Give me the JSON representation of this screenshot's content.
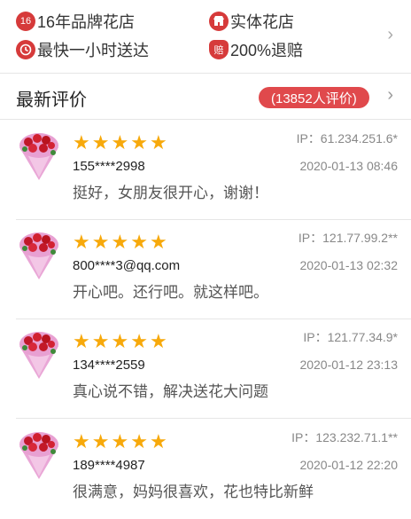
{
  "features": [
    {
      "icon": "16-years-icon",
      "icon_text": "16",
      "label": "16年品牌花店"
    },
    {
      "icon": "shop-icon",
      "icon_text": "",
      "label": "实体花店"
    },
    {
      "icon": "clock-icon",
      "icon_text": "",
      "label": "最快一小时送达"
    },
    {
      "icon": "refund-icon",
      "icon_text": "赔",
      "label": "200%退赔"
    }
  ],
  "reviews_header": {
    "title": "最新评价",
    "count": "(13852人评价)"
  },
  "rating_stars": 5,
  "reviews": [
    {
      "ip": "IP：61.234.251.6*",
      "user": "155****2998",
      "time": "2020-01-13 08:46",
      "text": "挺好，女朋友很开心，谢谢！"
    },
    {
      "ip": "IP：121.77.99.2**",
      "user": "800****3@qq.com",
      "time": "2020-01-13 02:32",
      "text": "开心吧。还行吧。就这样吧。"
    },
    {
      "ip": "IP：121.77.34.9*",
      "user": "134****2559",
      "time": "2020-01-12 23:13",
      "text": "真心说不错，解决送花大问题"
    },
    {
      "ip": "IP：123.232.71.1**",
      "user": "189****4987",
      "time": "2020-01-12 22:20",
      "text": "很满意，妈妈很喜欢，花也特比新鲜"
    }
  ],
  "colors": {
    "accent": "#e0494c",
    "star": "#f7a90b"
  }
}
